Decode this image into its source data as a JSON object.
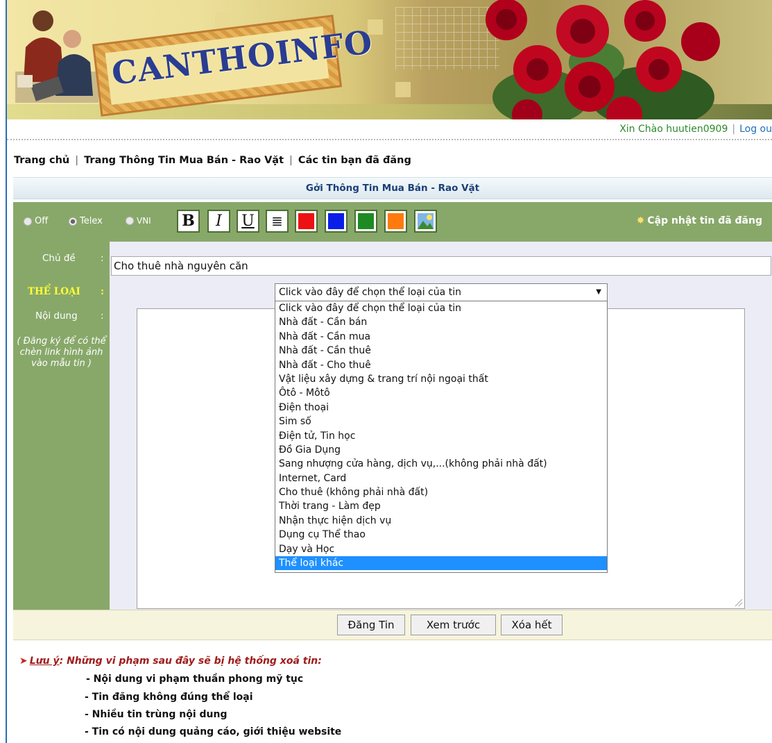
{
  "banner": {
    "logo_text": "CANTHOINFO"
  },
  "greeting": {
    "text": "Xin Chào huutien0909",
    "logout": "Log ou"
  },
  "topnav": {
    "home": "Trang chủ",
    "market": "Trang Thông Tin Mua Bán - Rao Vặt",
    "my_posts": "Các tin bạn đã đăng"
  },
  "form": {
    "title": "Gởi Thông Tin Mua Bán - Rao Vặt",
    "typing_modes": [
      "Off",
      "Telex",
      "VNI"
    ],
    "selected_mode": "Telex",
    "format_buttons": {
      "bold": "B",
      "italic": "I",
      "underline": "U",
      "align": "≣"
    },
    "colors": [
      "#ee1111",
      "#0a1ee8",
      "#1d8b22",
      "#ff7a0d"
    ],
    "update_link": "Cập nhật tin đã đăng",
    "labels": {
      "subject": "Chủ đề",
      "category": "THỂ LOẠI",
      "content": "Nội dung",
      "colon": ":",
      "note": "( Đăng ký để có thể chèn link hình ảnh vào mẫu tin )"
    },
    "subject_value": "Cho thuê nhà nguyên căn",
    "category_selected": "Click vào đây để chọn thể loại của tin",
    "category_options": [
      "Click vào đây để chọn thể loại của tin",
      "Nhà đất - Cần bán",
      "Nhà đất - Cần mua",
      "Nhà đất - Cần thuê",
      "Nhà đất - Cho thuê",
      "Vật liệu xây dựng & trang trí nội ngoại thất",
      "Ôtô - Môtô",
      "Điện thoại",
      "Sim số",
      "Điện tử, Tin học",
      "Đồ Gia Dụng",
      "Sang nhượng cửa hàng, dịch vụ,...(không phải nhà đất)",
      "Internet, Card",
      "Cho thuê (không phải nhà đất)",
      "Thời trang - Làm đẹp",
      "Nhận thực hiện dịch vụ",
      "Dụng cụ Thể thao",
      "Dạy và Học",
      "Thể loại khác"
    ],
    "highlighted_option": "Thể loại khác",
    "buttons": {
      "submit": "Đăng Tin",
      "preview": "Xem trước",
      "clear": "Xóa hết"
    }
  },
  "notes": {
    "heading_label": "Lưu ý",
    "heading_text": ": Những vi phạm sau đây sẽ bị hệ thống xoá tin:",
    "rules": [
      "- Nội dung vi phạm thuần phong mỹ tục",
      "- Tin đăng không đúng thể loại",
      "- Nhiều tin trùng nội dung",
      "- Tin có nội dung quảng cáo, giới thiệu website"
    ]
  }
}
